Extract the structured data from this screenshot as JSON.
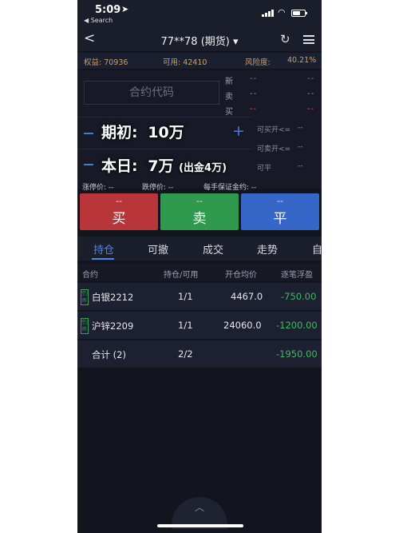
{
  "status_bar": {
    "time": "5:09",
    "location_arrow": "➤",
    "back_app": "◀ Search"
  },
  "nav": {
    "back_symbol": "<",
    "title": "77**78 (期货) ▾",
    "refresh_symbol": "↻"
  },
  "account": {
    "equity": "权益: 70936",
    "available": "可用: 42410",
    "risk_label": "风险度:",
    "risk_value": "40.21%"
  },
  "order": {
    "code_placeholder": "合约代码",
    "quotes": [
      {
        "label": "新",
        "v1": "--",
        "v2": "--"
      },
      {
        "label": "卖",
        "v1": "--",
        "v2": "--"
      },
      {
        "label": "买",
        "v1": "--",
        "v2": "--"
      }
    ],
    "overlay_line1_label": "期初:",
    "overlay_line1_value": "10万",
    "overlay_line2_label": "本日:",
    "overlay_line2_value": "7万",
    "overlay_line2_note": "(出金4万)",
    "limits": [
      {
        "label": "可买开<=",
        "value": "--"
      },
      {
        "label": "可卖开<=",
        "value": "--"
      },
      {
        "label": "可平",
        "value": "--"
      }
    ]
  },
  "price_strip": {
    "limit_up": "涨停价: --",
    "limit_down": "跌停价: --",
    "margin": "每手保证金约: --"
  },
  "trade_buttons": {
    "buy": {
      "top": "--",
      "label": "买"
    },
    "sell": {
      "top": "--",
      "label": "卖"
    },
    "close": {
      "top": "--",
      "label": "平"
    }
  },
  "tabs": [
    {
      "label": "持仓",
      "active": true
    },
    {
      "label": "可撤"
    },
    {
      "label": "成交"
    },
    {
      "label": "走势"
    },
    {
      "label": "自"
    }
  ],
  "positions_table": {
    "columns": [
      "合约",
      "持仓/可用",
      "开仓均价",
      "逐笔浮盈"
    ],
    "rows": [
      {
        "badge": "空/昨",
        "contract": "白银2212",
        "qty": "1/1",
        "avg_price": "4467.0",
        "pnl": "-750.00"
      },
      {
        "badge": "空/昨",
        "contract": "沪锌2209",
        "qty": "1/1",
        "avg_price": "24060.0",
        "pnl": "-1200.00"
      }
    ],
    "total": {
      "label": "合计 (2)",
      "qty": "2/2",
      "pnl": "-1950.00"
    }
  },
  "colors": {
    "buy": "#b83539",
    "sell": "#2f9a4e",
    "close": "#3566c8",
    "accent": "#4f86e6",
    "profit_text": "#3dbb62",
    "account_text": "#c9a16a"
  },
  "icons": [
    "location-arrow-icon",
    "signal-icon",
    "wifi-icon",
    "battery-icon",
    "back-chevron-icon",
    "refresh-icon",
    "menu-icon",
    "minus-icon",
    "plus-icon",
    "chevron-up-icon"
  ]
}
